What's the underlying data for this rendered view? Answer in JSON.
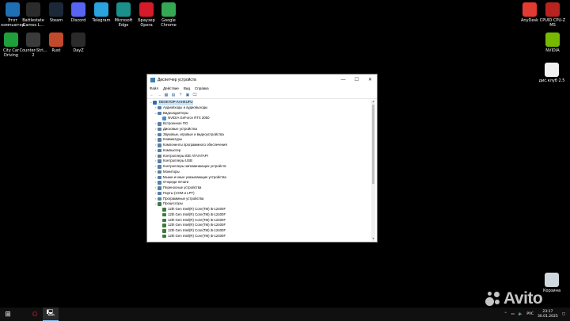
{
  "desktop": {
    "icons_left": [
      {
        "label": "Этот\nкомпьютер",
        "icon": "this-pc-icon",
        "color": "#1f6fb5"
      },
      {
        "label": "Battlestate\nGames L...",
        "icon": "battlestate-icon",
        "color": "#2b2b2b"
      },
      {
        "label": "Steam",
        "icon": "steam-icon",
        "color": "#1b2838"
      },
      {
        "label": "Discord",
        "icon": "discord-icon",
        "color": "#5865f2"
      },
      {
        "label": "Telegram",
        "icon": "telegram-icon",
        "color": "#2aa3de"
      },
      {
        "label": "Microsoft\nEdge",
        "icon": "edge-icon",
        "color": "#1b8f8a"
      },
      {
        "label": "Браузер\nOpera",
        "icon": "opera-icon",
        "color": "#d51b2a"
      },
      {
        "label": "Google\nChrome",
        "icon": "chrome-icon",
        "color": "#34a853"
      }
    ],
    "icons_left_row2": [
      {
        "label": "City Car\nDriving",
        "icon": "citycar-icon",
        "color": "#1f9e3c"
      },
      {
        "label": "Counter-Stri...\n2",
        "icon": "cs2-icon",
        "color": "#3a3a3a"
      },
      {
        "label": "Rust",
        "icon": "rust-icon",
        "color": "#c24a2c"
      },
      {
        "label": "DayZ",
        "icon": "dayz-icon",
        "color": "#2a2a2a"
      }
    ],
    "icons_right": [
      {
        "label": "AnyDesk",
        "icon": "anydesk-icon",
        "color": "#e23c32"
      },
      {
        "label": "CPUID CPU-Z\nMS",
        "icon": "cpuz-icon",
        "color": "#b8231f"
      },
      {
        "label": "NVIDIA",
        "icon": "nvidia-icon",
        "color": "#76b900"
      },
      {
        "label": "дис.клуб 2.5",
        "icon": "file-icon",
        "color": "#f1f1f1"
      },
      {
        "label": "Корзина",
        "icon": "recycle-bin-icon",
        "color": "#cfd8dc"
      }
    ]
  },
  "window": {
    "title": "Диспетчер устройств",
    "controls": {
      "minimize": "—",
      "maximize": "☐",
      "close": "✕"
    },
    "menu": [
      "Файл",
      "Действие",
      "Вид",
      "Справка"
    ],
    "toolbar": [
      "←",
      "→",
      "▦",
      "▤",
      "?",
      "▣",
      "🖵"
    ],
    "tree": [
      {
        "label": "DESKTOP-AAHKUFU",
        "level": 0,
        "arrow": "⌄",
        "icon": "pc",
        "root": true
      },
      {
        "label": "Аудиовходы и аудиовыходы",
        "level": 1,
        "arrow": "›"
      },
      {
        "label": "Видеоадаптеры",
        "level": 1,
        "arrow": "⌄"
      },
      {
        "label": "NVIDIA GeForce RTX 3050",
        "level": 2,
        "arrow": "",
        "icon": "gpu"
      },
      {
        "label": "Встроенное ПО",
        "level": 1,
        "arrow": "›"
      },
      {
        "label": "Дисковые устройства",
        "level": 1,
        "arrow": "›"
      },
      {
        "label": "Звуковые, игровые и видеоустройства",
        "level": 1,
        "arrow": "›"
      },
      {
        "label": "Клавиатуры",
        "level": 1,
        "arrow": "›"
      },
      {
        "label": "Компоненты программного обеспечения",
        "level": 1,
        "arrow": "›"
      },
      {
        "label": "Компьютер",
        "level": 1,
        "arrow": "›"
      },
      {
        "label": "Контроллеры IDE ATA/ATAPI",
        "level": 1,
        "arrow": "›"
      },
      {
        "label": "Контроллеры USB",
        "level": 1,
        "arrow": "›"
      },
      {
        "label": "Контроллеры запоминающих устройств",
        "level": 1,
        "arrow": "›"
      },
      {
        "label": "Мониторы",
        "level": 1,
        "arrow": "›"
      },
      {
        "label": "Мыши и иные указывающие устройства",
        "level": 1,
        "arrow": "›"
      },
      {
        "label": "Очереди печати",
        "level": 1,
        "arrow": "›"
      },
      {
        "label": "Переносные устройства",
        "level": 1,
        "arrow": "›"
      },
      {
        "label": "Порты (COM и LPT)",
        "level": 1,
        "arrow": "›"
      },
      {
        "label": "Программные устройства",
        "level": 1,
        "arrow": "›"
      },
      {
        "label": "Процессоры",
        "level": 1,
        "arrow": "⌄",
        "icon": "cpu"
      },
      {
        "label": "12th Gen Intel(R) Core(TM) i5-12400F",
        "level": 2,
        "arrow": "",
        "icon": "cpu"
      },
      {
        "label": "12th Gen Intel(R) Core(TM) i5-12400F",
        "level": 2,
        "arrow": "",
        "icon": "cpu"
      },
      {
        "label": "12th Gen Intel(R) Core(TM) i5-12400F",
        "level": 2,
        "arrow": "",
        "icon": "cpu"
      },
      {
        "label": "12th Gen Intel(R) Core(TM) i5-12400F",
        "level": 2,
        "arrow": "",
        "icon": "cpu"
      },
      {
        "label": "12th Gen Intel(R) Core(TM) i5-12400F",
        "level": 2,
        "arrow": "",
        "icon": "cpu"
      },
      {
        "label": "12th Gen Intel(R) Core(TM) i5-12400F",
        "level": 2,
        "arrow": "",
        "icon": "cpu"
      }
    ]
  },
  "taskbar": {
    "start": "⊞",
    "apps": [
      {
        "icon": "opera-icon",
        "glyph": "O",
        "color": "#d51b2a"
      },
      {
        "icon": "device-manager-icon",
        "glyph": "🖳",
        "color": "#ffffff",
        "active": true
      }
    ],
    "tray": {
      "lang": "РУС",
      "time": "23:17",
      "date": "30.01.2025"
    }
  },
  "watermark": "Avito"
}
